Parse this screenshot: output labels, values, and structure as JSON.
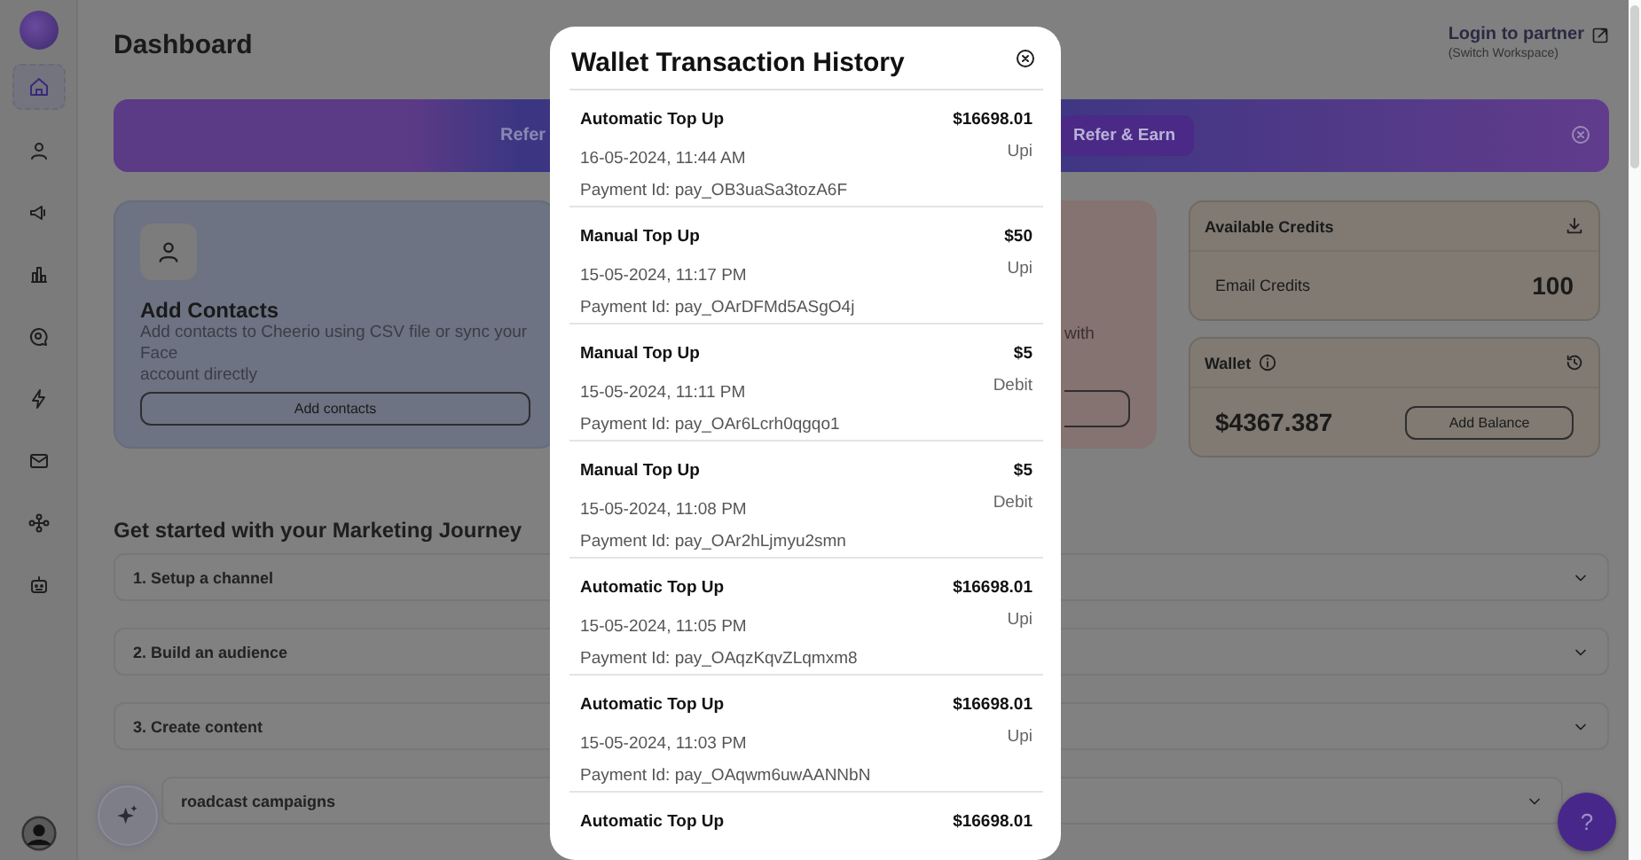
{
  "sidebar": {
    "items": [
      {
        "selected": true
      },
      {
        "selected": false
      },
      {
        "selected": false
      },
      {
        "selected": false
      },
      {
        "selected": false
      },
      {
        "selected": false
      },
      {
        "selected": false
      },
      {
        "selected": false
      },
      {
        "selected": false
      }
    ]
  },
  "header": {
    "title": "Dashboard",
    "partner_link": "Login to partner",
    "workspace_note": "(Switch Workspace)"
  },
  "banner": {
    "text": "Refer",
    "button": "Refer & Earn"
  },
  "contacts_card": {
    "title": "Add Contacts",
    "description_lines": [
      "Add contacts to Cheerio using CSV file or sync your Face",
      "account directly"
    ],
    "button": "Add contacts"
  },
  "second_card": {
    "text": "with"
  },
  "credits": {
    "title": "Available Credits",
    "label": "Email Credits",
    "value": "100"
  },
  "wallet": {
    "title": "Wallet",
    "balance": "$4367.387",
    "button": "Add Balance"
  },
  "journey": {
    "title": "Get started with your Marketing Journey",
    "steps": [
      {
        "label": "1. Setup a channel",
        "expanded": false
      },
      {
        "label": "2. Build an audience",
        "expanded": false
      },
      {
        "label": "3. Create content",
        "expanded": false
      },
      {
        "label": "roadcast campaigns",
        "expanded": false
      }
    ]
  },
  "help_button": "?",
  "modal": {
    "title": "Wallet Transaction History",
    "transactions": [
      {
        "type": "Automatic Top Up",
        "amount": "$16698.01",
        "date": "16-05-2024, 11:44 AM",
        "payment_id": "Payment Id: pay_OB3uaSa3tozA6F",
        "method": "Upi"
      },
      {
        "type": "Manual Top Up",
        "amount": "$50",
        "date": "15-05-2024, 11:17 PM",
        "payment_id": "Payment Id: pay_OArDFMd5ASgO4j",
        "method": "Upi"
      },
      {
        "type": "Manual Top Up",
        "amount": "$5",
        "date": "15-05-2024, 11:11 PM",
        "payment_id": "Payment Id: pay_OAr6Lcrh0qgqo1",
        "method": "Debit"
      },
      {
        "type": "Manual Top Up",
        "amount": "$5",
        "date": "15-05-2024, 11:08 PM",
        "payment_id": "Payment Id: pay_OAr2hLjmyu2smn",
        "method": "Debit"
      },
      {
        "type": "Automatic Top Up",
        "amount": "$16698.01",
        "date": "15-05-2024, 11:05 PM",
        "payment_id": "Payment Id: pay_OAqzKqvZLqmxm8",
        "method": "Upi"
      },
      {
        "type": "Automatic Top Up",
        "amount": "$16698.01",
        "date": "15-05-2024, 11:03 PM",
        "payment_id": "Payment Id: pay_OAqwm6uwAANNbN",
        "method": "Upi"
      },
      {
        "type": "Automatic Top Up",
        "amount": "$16698.01"
      }
    ]
  }
}
